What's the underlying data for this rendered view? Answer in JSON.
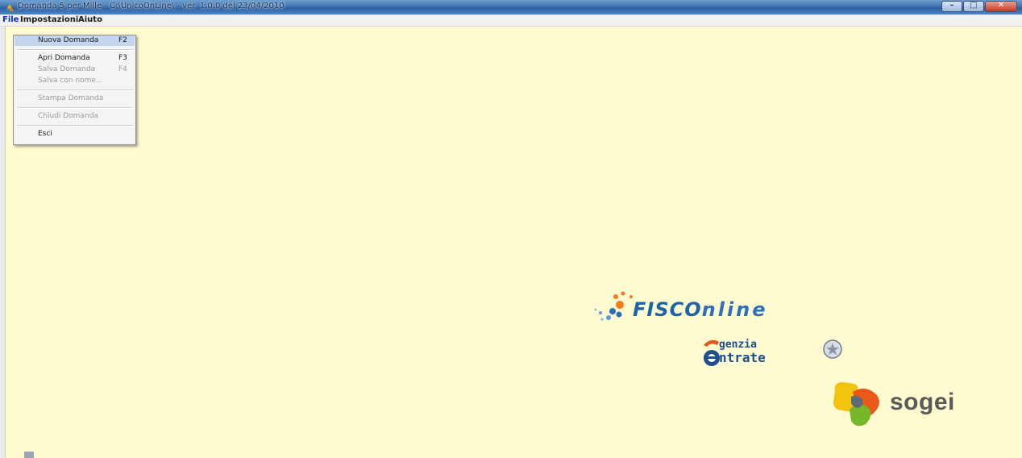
{
  "window": {
    "title": "Domanda 5 per Mille - C:\\UnicoOnLine\\  -  ver. 1.0.0 del 23/04/2010",
    "buttons": {
      "minimize_icon": "minimize-icon",
      "maximize_icon": "maximize-icon",
      "close_icon": "close-icon"
    }
  },
  "menubar": {
    "items": [
      {
        "label": "File"
      },
      {
        "label": "Impostazioni"
      },
      {
        "label": "Aiuto"
      }
    ]
  },
  "file_menu": {
    "items": [
      {
        "label": "Nuova Domanda",
        "shortcut": "F2"
      },
      {
        "label": "Apri Domanda",
        "shortcut": "F3"
      },
      {
        "label": "Salva Domanda",
        "shortcut": "F4"
      },
      {
        "label": "Salva con nome...",
        "shortcut": ""
      },
      {
        "label": "Stampa Domanda",
        "shortcut": ""
      },
      {
        "label": "Chiudi Domanda",
        "shortcut": ""
      },
      {
        "label": "Esci",
        "shortcut": ""
      }
    ]
  },
  "logos": {
    "fisco": {
      "part1": "FISCO",
      "part2": "nline"
    },
    "agenzia": {
      "line1": "genzia",
      "line2": "ntrate"
    },
    "sogei": {
      "text": "sogei"
    }
  },
  "colors": {
    "client_bg": "#fffbd1",
    "menu_highlight": "#c4d5ee",
    "active_menu": "#0a28c8"
  }
}
